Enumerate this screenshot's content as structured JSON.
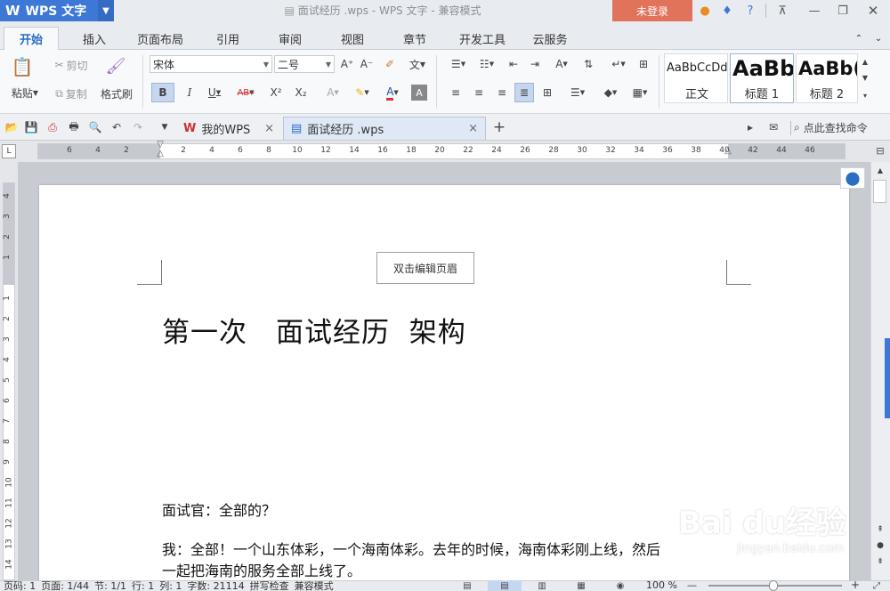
{
  "app": {
    "name": "WPS 文字",
    "window_title": "面试经历 .wps - WPS 文字 - 兼容模式",
    "login_label": "未登录"
  },
  "menu_tabs": [
    {
      "label": "开始"
    },
    {
      "label": "插入"
    },
    {
      "label": "页面布局"
    },
    {
      "label": "引用"
    },
    {
      "label": "审阅"
    },
    {
      "label": "视图"
    },
    {
      "label": "章节"
    },
    {
      "label": "开发工具"
    },
    {
      "label": "云服务"
    }
  ],
  "ribbon": {
    "paste": "粘贴",
    "cut": "剪切",
    "copy": "复制",
    "format_painter": "格式刷",
    "font": "宋体",
    "font_size": "二号",
    "bold": "B",
    "italic": "I",
    "underline": "U",
    "strike": "AB",
    "superscript": "X²",
    "subscript": "X₂",
    "grow_font": "A⁺",
    "shrink_font": "A⁻",
    "font_color": "A",
    "styles": [
      {
        "preview": "AaBbCcDd",
        "name": "正文"
      },
      {
        "preview": "AaBb",
        "name": "标题 1"
      },
      {
        "preview": "AaBb(",
        "name": "标题 2"
      }
    ]
  },
  "doc_tabs": [
    {
      "label": "我的WPS",
      "close": "×"
    },
    {
      "label": "面试经历 .wps",
      "close": "×"
    }
  ],
  "search_command": "点此查找命令",
  "ruler_numbers": [
    "6",
    "4",
    "2",
    "",
    "2",
    "4",
    "6",
    "8",
    "10",
    "12",
    "14",
    "16",
    "18",
    "20",
    "22",
    "24",
    "26",
    "28",
    "30",
    "32",
    "34",
    "36",
    "38",
    "40",
    "42",
    "44",
    "46"
  ],
  "vruler_numbers": [
    "4",
    "3",
    "2",
    "1",
    "",
    "1",
    "2",
    "3",
    "4",
    "5",
    "6",
    "7",
    "8",
    "9",
    "10",
    "11",
    "12",
    "13",
    "14"
  ],
  "document": {
    "header_button": "双击编辑页眉",
    "title": "第一次　面试经历  架构",
    "paragraphs": [
      "面试官：全部的？",
      "我：全部！一个山东体彩，一个海南体彩。去年的时候，海南体彩刚上线，然后",
      "一起把海南的服务全部上线了。"
    ]
  },
  "status": {
    "page_num": "页码: 1",
    "page": "页面: 1/44",
    "section": "节: 1/1",
    "row": "行: 1",
    "col": "列: 1",
    "words": "字数: 21114",
    "spell": "拼写检查",
    "mode": "兼容模式",
    "zoom": "100 %",
    "zoom_minus": "—",
    "zoom_plus": "+"
  },
  "watermark": {
    "brand": "Bai du经验",
    "url": "jingyan.baidu.com"
  },
  "colors": {
    "accent": "#3d78d6",
    "login": "#e0735a",
    "active_tab": "#2b6cc4"
  }
}
